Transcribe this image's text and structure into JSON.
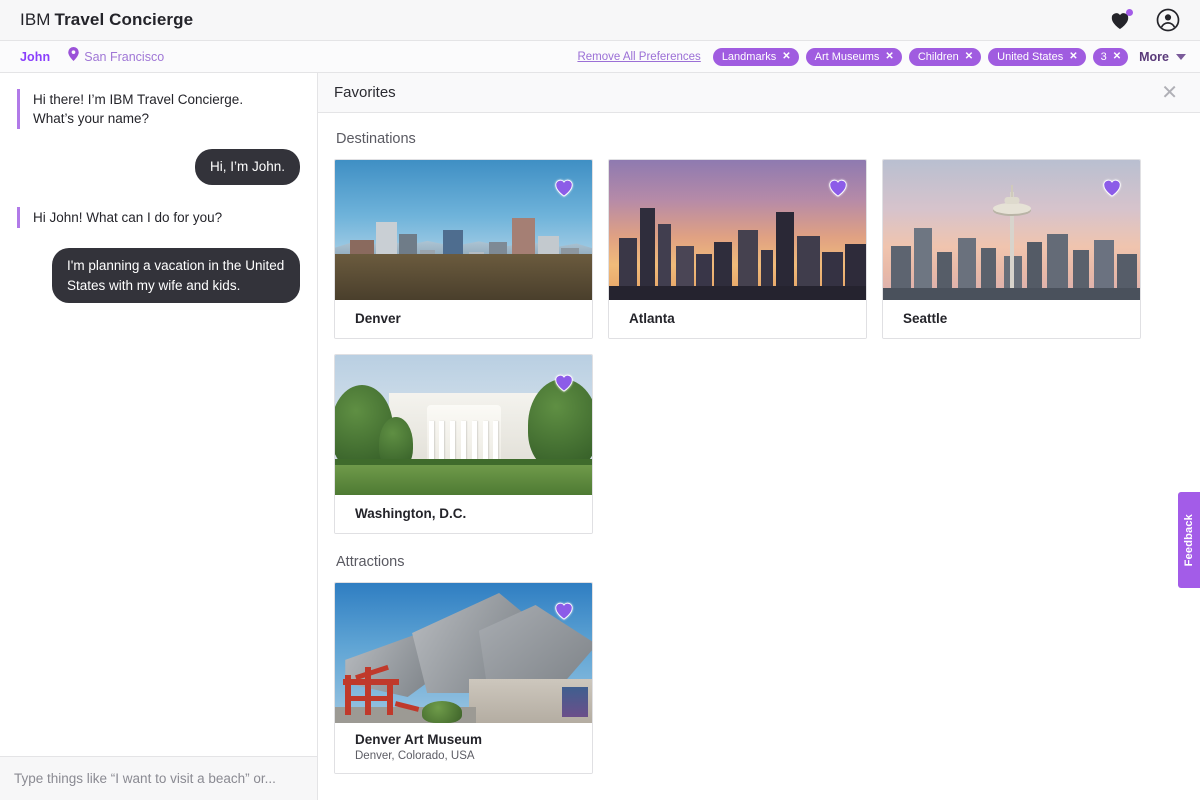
{
  "header": {
    "brand_prefix": "IBM",
    "brand_name": "Travel Concierge",
    "favorites_icon": "heart-icon",
    "account_icon": "user-account-icon",
    "has_notification": true
  },
  "preference_bar": {
    "user_name": "John",
    "location_icon": "location-pin-icon",
    "location": "San Francisco",
    "remove_all_label": "Remove All Preferences",
    "tags": [
      {
        "label": "Landmarks",
        "remove": "✕"
      },
      {
        "label": "Art Museums",
        "remove": "✕"
      },
      {
        "label": "Children",
        "remove": "✕"
      },
      {
        "label": "United States",
        "remove": "✕"
      }
    ],
    "overflow_count": "3",
    "overflow_remove": "✕",
    "more_label": "More",
    "more_icon": "chevron-down-icon"
  },
  "chat": {
    "messages": [
      {
        "from": "bot",
        "text": "Hi there! I’m IBM Travel Concierge. What’s your name?"
      },
      {
        "from": "user",
        "text": "Hi, I’m John."
      },
      {
        "from": "bot",
        "text": "Hi John! What can I do for you?"
      },
      {
        "from": "user",
        "text": "I'm planning a vacation in the United States with my wife and kids."
      }
    ],
    "input_value": "",
    "input_placeholder": "Type things like “I want to visit a beach” or..."
  },
  "favorites_panel": {
    "title": "Favorites",
    "close_icon": "close-icon",
    "sections": [
      {
        "title": "Destinations",
        "cards": [
          {
            "name": "Denver",
            "subtitle": "",
            "scene": "denver",
            "favorited": true,
            "heart_icon": "heart-filled-icon"
          },
          {
            "name": "Atlanta",
            "subtitle": "",
            "scene": "atlanta",
            "favorited": true,
            "heart_icon": "heart-filled-icon"
          },
          {
            "name": "Seattle",
            "subtitle": "",
            "scene": "seattle",
            "favorited": true,
            "heart_icon": "heart-filled-icon"
          },
          {
            "name": "Washington, D.C.",
            "subtitle": "",
            "scene": "dc",
            "favorited": true,
            "heart_icon": "heart-filled-icon"
          }
        ]
      },
      {
        "title": "Attractions",
        "cards": [
          {
            "name": "Denver Art Museum",
            "subtitle": "Denver, Colorado, USA",
            "scene": "museum",
            "favorited": true,
            "heart_icon": "heart-filled-icon"
          }
        ]
      }
    ]
  },
  "feedback": {
    "label": "Feedback"
  },
  "colors": {
    "accent_purple": "#a05ce8",
    "brand_purple": "#8a3ffc",
    "tag_purple": "#a05ce0",
    "user_bubble": "#33333a",
    "header_bg": "#f7f7f8"
  }
}
